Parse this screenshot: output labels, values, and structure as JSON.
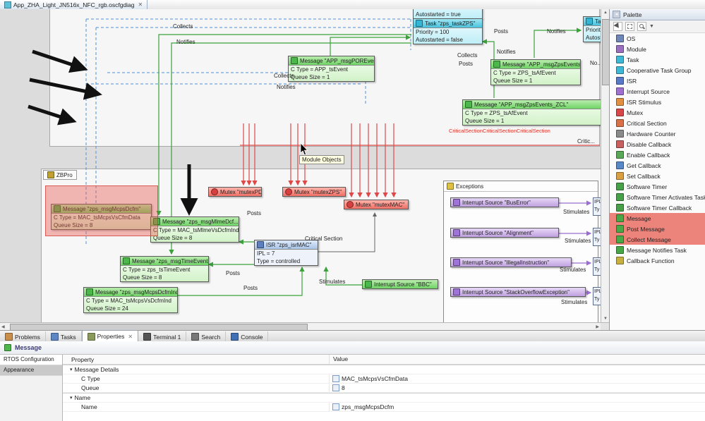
{
  "window": {
    "editor_tab": "App_ZHA_Light_JN516x_NFC_rgb.oscfgdiag",
    "close_glyph": "✕"
  },
  "colors": {
    "task": "#49c3de",
    "message": "#6fd465",
    "mutex": "#ef6f66",
    "isr": "#a8c4e8",
    "interrupt_source": "#bfa0e0",
    "highlight_red": "#e85f55",
    "wire_green": "#3aa23a",
    "wire_red": "#e04848",
    "wire_purple": "#9a6fd0",
    "wire_dashed_blue": "#4f90d9"
  },
  "diagram": {
    "tooltip": "Module Objects",
    "containers": {
      "zbpro": {
        "label": "ZBPro"
      },
      "exceptions": {
        "label": "Exceptions"
      }
    },
    "nodes": {
      "task_cut": {
        "lines": [
          "Autostarted = true"
        ]
      },
      "task_zps": {
        "title": "Task \"zps_taskZPS\"",
        "lines": [
          "Priority = 100",
          "Autostarted = false"
        ]
      },
      "task_right": {
        "title": "Task \"z",
        "lines": [
          "Priority =",
          "Autostar"
        ]
      },
      "msg_por": {
        "title": "Message \"APP_msgPOREven...\"",
        "lines": [
          "C Type = APP_tsEvent",
          "Queue Size = 1"
        ]
      },
      "msg_zps_events": {
        "title": "Message \"APP_msgZpsEvents\"",
        "lines": [
          "C Type = ZPS_tsAfEvent",
          "Queue Size = 1"
        ]
      },
      "msg_zps_events_zcl": {
        "title": "Message \"APP_msgZpsEvents_ZCL\"",
        "lines": [
          "C Type = ZPS_tsAfEvent",
          "Queue Size = 1"
        ]
      },
      "mutex_pdum": {
        "title": "Mutex \"mutexPD...\""
      },
      "mutex_zps": {
        "title": "Mutex \"mutexZPS\""
      },
      "mutex_mac": {
        "title": "Mutex \"mutexMAC\""
      },
      "msg_mcps_dcfm": {
        "title": "Message \"zps_msgMcpsDcfm\"",
        "lines": [
          "C Type = MAC_tsMcpsVsCfmData",
          "Queue Size = 8"
        ]
      },
      "msg_mlme_dcfm": {
        "title": "Message \"zps_msgMlmeDcf...\"",
        "lines": [
          "C Type = MAC_tsMlmeVsDcfmInd",
          "Queue Size = 8"
        ]
      },
      "isr_mac": {
        "title": "ISR \"zps_isrMAC\"",
        "lines": [
          "IPL = 7",
          "Type = controlled"
        ]
      },
      "msg_time_events": {
        "title": "Message \"zps_msgTimeEvents\"",
        "lines": [
          "C Type = zps_tsTimeEvent",
          "Queue Size = 8"
        ]
      },
      "msg_mcps_dcfm_ind": {
        "title": "Message \"zps_msgMcpsDcfmInd\"",
        "lines": [
          "C Type = MAC_tsMcpsVsDcfmInd",
          "Queue Size = 24"
        ]
      },
      "int_bbc": {
        "title": "Interrupt Source \"BBC\""
      },
      "int_bus_error": {
        "title": "Interrupt Source \"BusError\""
      },
      "int_alignment": {
        "title": "Interrupt Source \"Alignment\""
      },
      "int_illegal": {
        "title": "Interrupt Source \"IllegalInstruction\""
      },
      "int_stack_overflow": {
        "title": "Interrupt Source \"StackOverflowException\""
      },
      "isr_cut": {
        "lines": [
          "IPL",
          "Ty"
        ]
      }
    },
    "edge_labels": {
      "posts": "Posts",
      "collects": "Collects",
      "notifies": "Notifies",
      "stimulates": "Stimulates",
      "critical_section": "Critical Section",
      "critical_clipped": "Critic...",
      "notifies_clipped": "No...",
      "critical_overlap": "CriticalSectionCriticalSectionCriticalSection"
    }
  },
  "palette": {
    "title": "Palette",
    "items": [
      {
        "label": "OS",
        "icon": "os-icon",
        "color": "#6f86b8"
      },
      {
        "label": "Module",
        "icon": "module-icon",
        "color": "#9a6fc0"
      },
      {
        "label": "Task",
        "icon": "task-icon",
        "color": "#3fb8d8"
      },
      {
        "label": "Cooperative Task Group",
        "icon": "cooperative-task-group-icon",
        "color": "#3fb8d8"
      },
      {
        "label": "ISR",
        "icon": "isr-icon",
        "color": "#5878c8"
      },
      {
        "label": "Interrupt Source",
        "icon": "interrupt-source-icon",
        "color": "#a070d0"
      },
      {
        "label": "ISR Stimulus",
        "icon": "isr-stimulus-icon",
        "color": "#e09040"
      },
      {
        "label": "Mutex",
        "icon": "mutex-icon",
        "color": "#d84848"
      },
      {
        "label": "Critical Section",
        "icon": "critical-section-icon",
        "color": "#d87048"
      },
      {
        "label": "Hardware Counter",
        "icon": "hardware-counter-icon",
        "color": "#8a8a8a"
      },
      {
        "label": "Disable Callback",
        "icon": "disable-callback-icon",
        "color": "#c86060"
      },
      {
        "label": "Enable Callback",
        "icon": "enable-callback-icon",
        "color": "#58a858"
      },
      {
        "label": "Get Callback",
        "icon": "get-callback-icon",
        "color": "#5888c8"
      },
      {
        "label": "Set Callback",
        "icon": "set-callback-icon",
        "color": "#d8a040"
      },
      {
        "label": "Software Timer",
        "icon": "software-timer-icon",
        "color": "#48a048"
      },
      {
        "label": "Software Timer Activates Task",
        "icon": "software-timer-activates-task-icon",
        "color": "#48a048"
      },
      {
        "label": "Software Timer Callback",
        "icon": "software-timer-callback-icon",
        "color": "#48a048"
      },
      {
        "label": "Message",
        "icon": "message-icon",
        "color": "#48a848",
        "hl": true
      },
      {
        "label": "Post Message",
        "icon": "post-message-icon",
        "color": "#48a848",
        "hl": true
      },
      {
        "label": "Collect Message",
        "icon": "collect-message-icon",
        "color": "#48a848",
        "hl": true
      },
      {
        "label": "Message Notifies Task",
        "icon": "message-notifies-task-icon",
        "color": "#48a848"
      },
      {
        "label": "Callback Function",
        "icon": "callback-function-icon",
        "color": "#c8b040"
      }
    ]
  },
  "bottom_tabs": [
    {
      "label": "Problems",
      "icon": "problems-icon",
      "color": "#c98f4a"
    },
    {
      "label": "Tasks",
      "icon": "tasks-icon",
      "color": "#5b87c6"
    },
    {
      "label": "Properties",
      "icon": "properties-icon",
      "color": "#8a9a5b",
      "active": true,
      "closable": true
    },
    {
      "label": "Terminal 1",
      "icon": "terminal-icon",
      "color": "#555555"
    },
    {
      "label": "Search",
      "icon": "search-icon",
      "color": "#777777"
    },
    {
      "label": "Console",
      "icon": "console-icon",
      "color": "#3f6fb5"
    }
  ],
  "properties_view": {
    "title": "Message",
    "close_glyph": "✕",
    "nav_items": [
      {
        "label": "RTOS Configuration"
      },
      {
        "label": "Appearance",
        "active": true
      }
    ],
    "columns": [
      "Property",
      "Value"
    ],
    "rows": [
      {
        "label": "Message Details",
        "is_group": true
      },
      {
        "label": "C Type",
        "value": "MAC_tsMcpsVsCfmData"
      },
      {
        "label": "Queue",
        "value": "8"
      },
      {
        "label": "Name",
        "is_group": true
      },
      {
        "label": "Name",
        "value": "zps_msgMcpsDcfm"
      }
    ]
  }
}
